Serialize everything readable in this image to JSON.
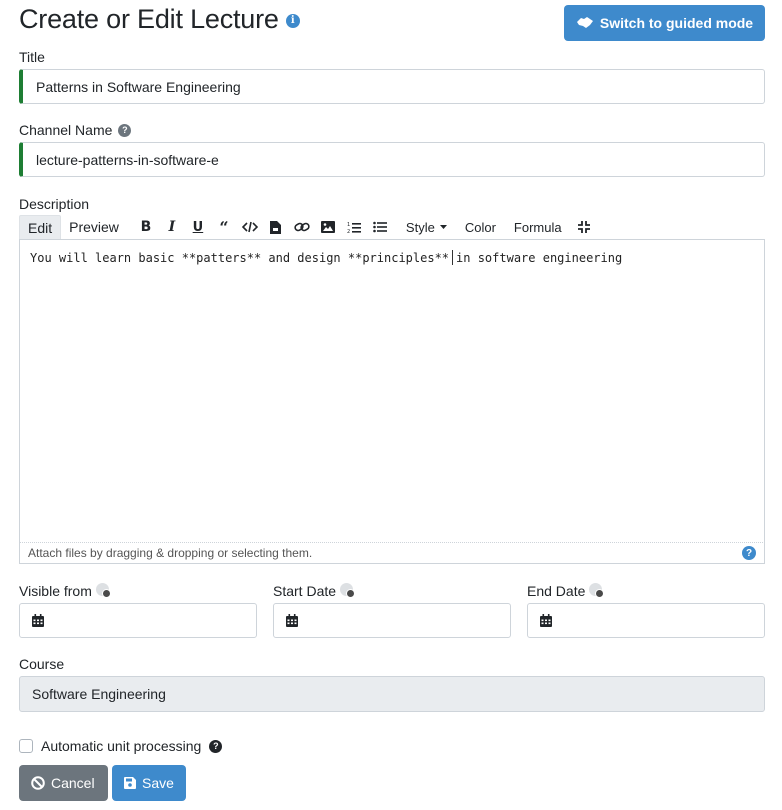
{
  "header": {
    "title": "Create or Edit Lecture",
    "info_icon": "info-circle-icon",
    "guided_button_label": "Switch to guided mode"
  },
  "form": {
    "title_label": "Title",
    "title_value": "Patterns in Software Engineering",
    "channel_label": "Channel Name",
    "channel_value": "lecture-patterns-in-software-e",
    "description_label": "Description",
    "editor": {
      "tabs": [
        "Edit",
        "Preview"
      ],
      "active_tab": "Edit",
      "tools": [
        "bold-icon",
        "italic-icon",
        "underline-icon",
        "quote-icon",
        "code-icon",
        "file-icon",
        "link-icon",
        "image-icon",
        "ordered-list-icon",
        "unordered-list-icon"
      ],
      "style_label": "Style",
      "color_label": "Color",
      "formula_label": "Formula",
      "content_before_cursor": "You will learn basic **patters** and design **principles**",
      "content_after_cursor": "in software engineering",
      "attach_hint": "Attach files by dragging & dropping or selecting them."
    },
    "visible_from_label": "Visible from",
    "start_date_label": "Start Date",
    "end_date_label": "End Date",
    "course_label": "Course",
    "course_value": "Software Engineering",
    "auto_unit_label": "Automatic unit processing",
    "auto_unit_checked": false
  },
  "actions": {
    "cancel_label": "Cancel",
    "save_label": "Save"
  },
  "colors": {
    "primary": "#3e8acc",
    "secondary": "#6c757d",
    "valid_border": "#1e7e34",
    "disabled_bg": "#e9ecef"
  }
}
